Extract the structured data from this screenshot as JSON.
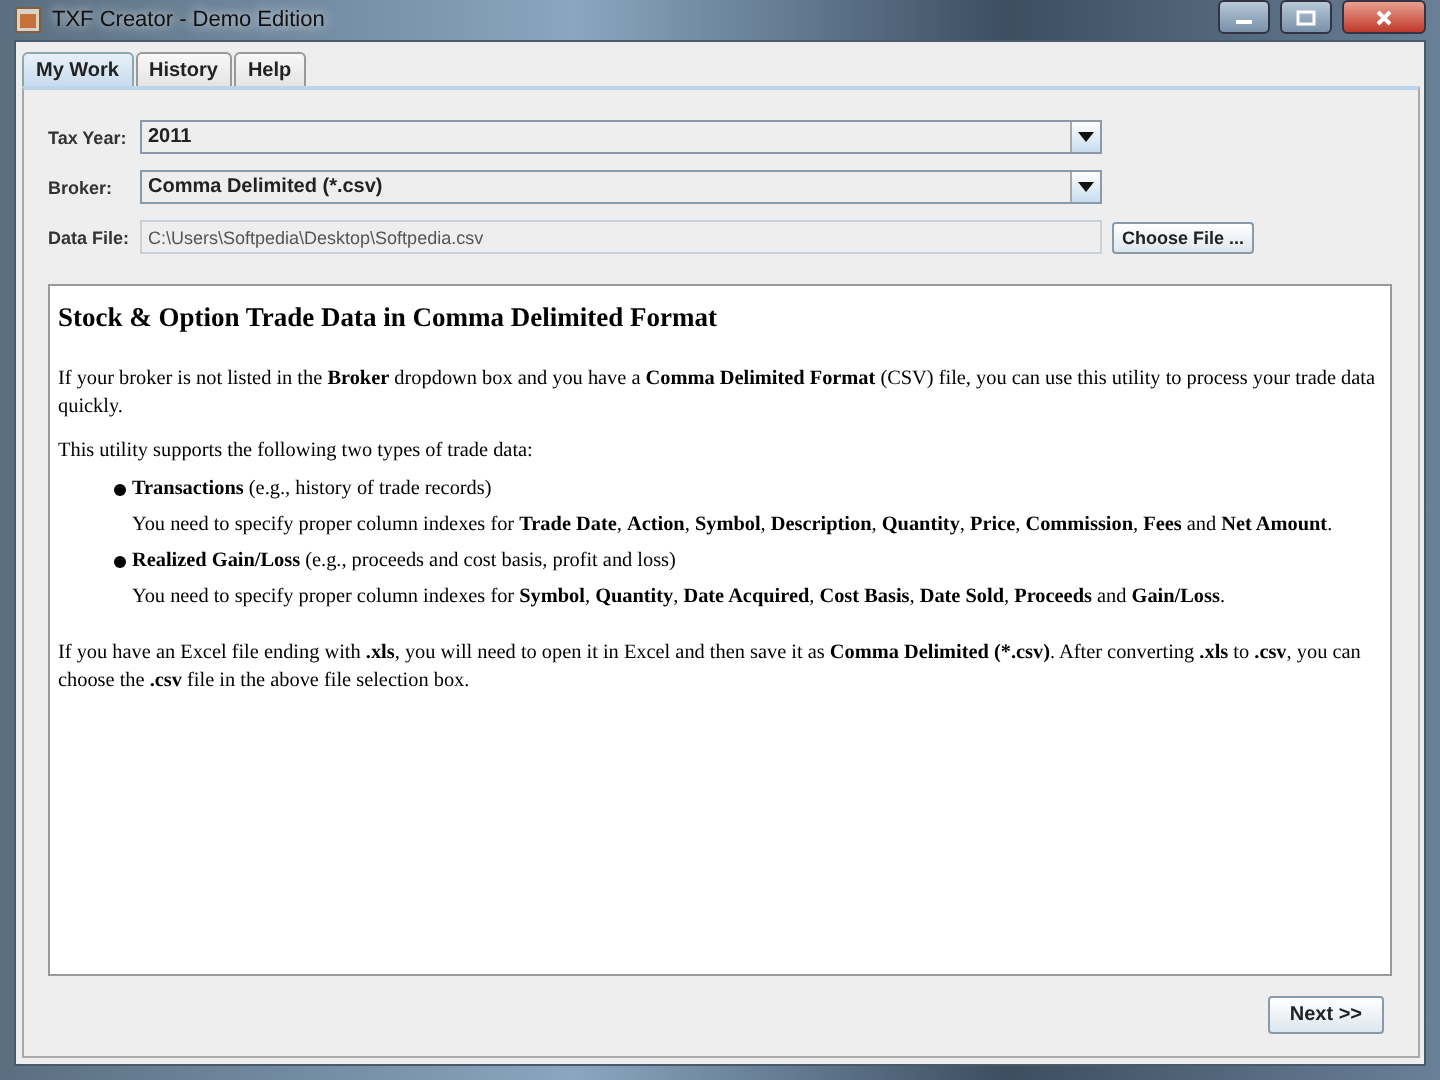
{
  "window": {
    "title": "TXF Creator - Demo Edition"
  },
  "tabs": [
    {
      "label": "My Work",
      "selected": true
    },
    {
      "label": "History",
      "selected": false
    },
    {
      "label": "Help",
      "selected": false
    }
  ],
  "form": {
    "tax_year": {
      "label": "Tax Year:",
      "value": "2011"
    },
    "broker": {
      "label": "Broker:",
      "value": "Comma Delimited (*.csv)"
    },
    "data_file": {
      "label": "Data File:",
      "value": "C:\\Users\\Softpedia\\Desktop\\Softpedia.csv",
      "button": "Choose File ..."
    }
  },
  "help": {
    "heading": "Stock & Option Trade Data in Comma Delimited Format",
    "intro": "If your broker is not listed in the **Broker** dropdown box and you have a **Comma Delimited Format** (CSV) file, you can use this utility to process your trade data quickly.",
    "lead": "This utility supports the following two types of trade data:",
    "items": [
      {
        "title": "**Transactions** (e.g., history of trade records)",
        "detail": "You need to specify proper column indexes for **Trade Date**, **Action**, **Symbol**, **Description**, **Quantity**, **Price**, **Commission**, **Fees** and **Net Amount**."
      },
      {
        "title": "**Realized Gain/Loss** (e.g., proceeds and cost basis, profit and loss)",
        "detail": "You need to specify proper column indexes for **Symbol**, **Quantity**, **Date Acquired**, **Cost Basis**, **Date Sold**, **Proceeds** and **Gain/Loss**."
      }
    ],
    "outro": "If you have an Excel file ending with **.xls**, you will need to open it in Excel and then save it as **Comma Delimited (*.csv)**. After converting **.xls** to **.csv**, you can choose the **.csv** file in the above file selection box."
  },
  "next_button": "Next >>"
}
